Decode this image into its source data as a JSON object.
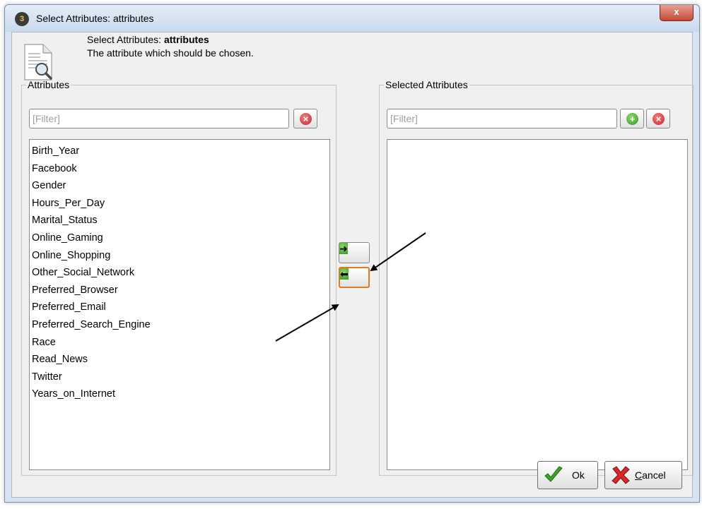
{
  "window": {
    "title": "Select Attributes: attributes",
    "app_icon_text": "3",
    "close_glyph": "x"
  },
  "header": {
    "line1_prefix": "Select Attributes: ",
    "line1_bold": "attributes",
    "line2": "The attribute which should be chosen.",
    "icon": "document-search-icon"
  },
  "left_panel": {
    "title": "Attributes",
    "filter_placeholder": "[Filter]",
    "clear_icon": "clear-filter-icon",
    "items": [
      "Birth_Year",
      "Facebook",
      "Gender",
      "Hours_Per_Day",
      "Marital_Status",
      "Online_Gaming",
      "Online_Shopping",
      "Other_Social_Network",
      "Preferred_Browser",
      "Preferred_Email",
      "Preferred_Search_Engine",
      "Race",
      "Read_News",
      "Twitter",
      "Years_on_Internet"
    ]
  },
  "right_panel": {
    "title": "Selected Attributes",
    "filter_placeholder": "[Filter]",
    "add_icon": "add-icon",
    "clear_icon": "clear-filter-icon",
    "items": []
  },
  "move_buttons": {
    "add_icon": "arrow-right-icon",
    "remove_icon": "arrow-left-icon"
  },
  "footer": {
    "ok_label": "Ok",
    "cancel_label": "Cancel"
  },
  "colors": {
    "accent_focus": "#e07b1f",
    "green_icon": "#2f9a1c",
    "red_icon": "#c8242a"
  }
}
